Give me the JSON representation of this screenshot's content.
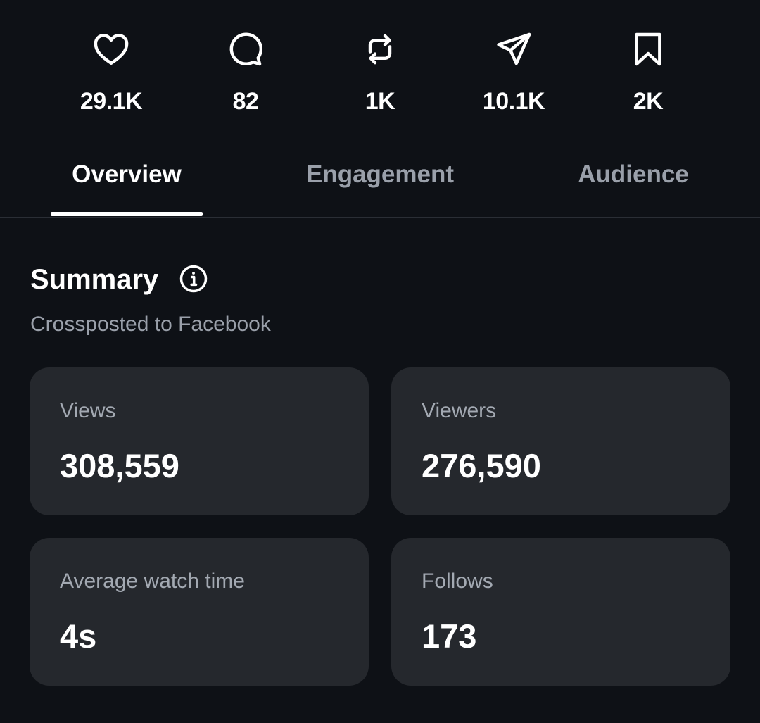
{
  "stats": {
    "likes": {
      "icon": "heart-icon",
      "count": "29.1K"
    },
    "comments": {
      "icon": "comment-icon",
      "count": "82"
    },
    "reposts": {
      "icon": "repost-icon",
      "count": "1K"
    },
    "shares": {
      "icon": "send-icon",
      "count": "10.1K"
    },
    "saves": {
      "icon": "bookmark-icon",
      "count": "2K"
    }
  },
  "tabs": {
    "overview": "Overview",
    "engagement": "Engagement",
    "audience": "Audience",
    "active": "overview"
  },
  "summary": {
    "title": "Summary",
    "info_icon": "info-icon",
    "subtitle": "Crossposted to Facebook"
  },
  "metrics": {
    "views": {
      "label": "Views",
      "value": "308,559"
    },
    "viewers": {
      "label": "Viewers",
      "value": "276,590"
    },
    "avg_watch": {
      "label": "Average watch time",
      "value": "4s"
    },
    "follows": {
      "label": "Follows",
      "value": "173"
    }
  },
  "colors": {
    "background": "#0e1116",
    "card": "#25282d",
    "text_primary": "#ffffff",
    "text_secondary": "#9aa0aa"
  }
}
